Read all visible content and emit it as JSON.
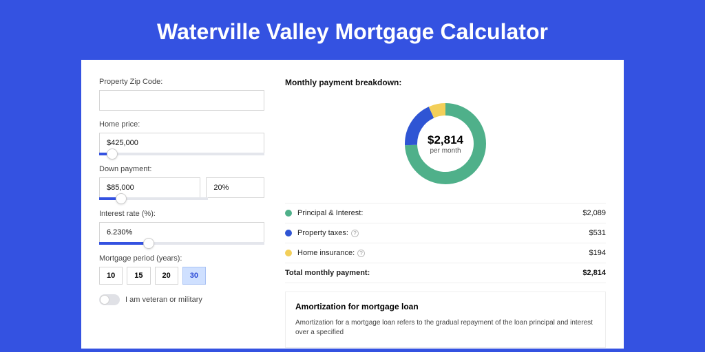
{
  "title": "Waterville Valley Mortgage Calculator",
  "form": {
    "zip_label": "Property Zip Code:",
    "zip_value": "",
    "home_price_label": "Home price:",
    "home_price_value": "$425,000",
    "home_price_slider_pct": 8,
    "down_payment_label": "Down payment:",
    "down_payment_value": "$85,000",
    "down_payment_pct_value": "20%",
    "down_payment_slider_pct": 20,
    "interest_label": "Interest rate (%):",
    "interest_value": "6.230%",
    "interest_slider_pct": 30,
    "period_label": "Mortgage period (years):",
    "periods": [
      "10",
      "15",
      "20",
      "30"
    ],
    "period_selected": "30",
    "veteran_label": "I am veteran or military",
    "veteran_on": false
  },
  "breakdown": {
    "title": "Monthly payment breakdown:",
    "center_amount": "$2,814",
    "center_sub": "per month",
    "rows": [
      {
        "label": "Principal & Interest:",
        "value": "$2,089",
        "color": "#4fb08a",
        "pct": 74.24
      },
      {
        "label": "Property taxes:",
        "value": "$531",
        "color": "#2f55d4",
        "pct": 18.87,
        "info": true
      },
      {
        "label": "Home insurance:",
        "value": "$194",
        "color": "#f3cf59",
        "pct": 6.89,
        "info": true
      }
    ],
    "total_label": "Total monthly payment:",
    "total_value": "$2,814"
  },
  "amort": {
    "title": "Amortization for mortgage loan",
    "text": "Amortization for a mortgage loan refers to the gradual repayment of the loan principal and interest over a specified"
  },
  "chart_data": {
    "type": "pie",
    "title": "Monthly payment breakdown",
    "series": [
      {
        "name": "Principal & Interest",
        "value": 2089,
        "color": "#4fb08a"
      },
      {
        "name": "Property taxes",
        "value": 531,
        "color": "#2f55d4"
      },
      {
        "name": "Home insurance",
        "value": 194,
        "color": "#f3cf59"
      }
    ],
    "total": 2814,
    "center_label": "$2,814 per month"
  }
}
